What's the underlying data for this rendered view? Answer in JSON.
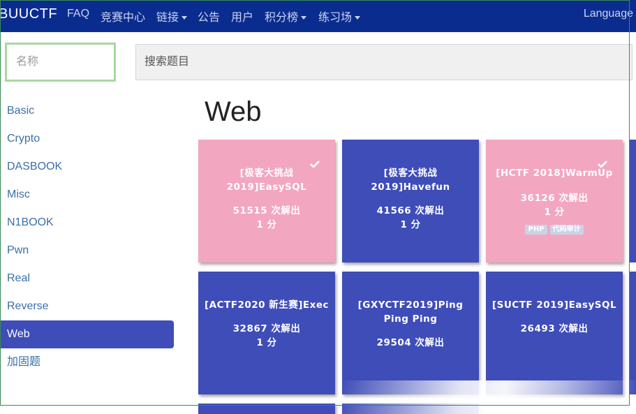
{
  "navbar": {
    "brand": "BUUCTF",
    "items": [
      {
        "label": "FAQ",
        "dropdown": false
      },
      {
        "label": "竞赛中心",
        "dropdown": false
      },
      {
        "label": "链接",
        "dropdown": true
      },
      {
        "label": "公告",
        "dropdown": false
      },
      {
        "label": "用户",
        "dropdown": false
      },
      {
        "label": "积分榜",
        "dropdown": true
      },
      {
        "label": "练习场",
        "dropdown": true
      }
    ],
    "language": "Language"
  },
  "filters": {
    "name_placeholder": "名称",
    "search_placeholder": "搜索题目"
  },
  "sidebar": {
    "items": [
      {
        "label": "Basic"
      },
      {
        "label": "Crypto"
      },
      {
        "label": "DASBOOK"
      },
      {
        "label": "Misc"
      },
      {
        "label": "N1BOOK"
      },
      {
        "label": "Pwn"
      },
      {
        "label": "Real"
      },
      {
        "label": "Reverse"
      },
      {
        "label": "Web",
        "active": true
      },
      {
        "label": "加固题"
      }
    ]
  },
  "main": {
    "title": "Web",
    "challenges": [
      {
        "name": "[极客大挑战 2019]EasySQL",
        "solves": "51515 次解出",
        "points": "1 分",
        "solved": true,
        "color": "pink",
        "tags": []
      },
      {
        "name": "[极客大挑战 2019]Havefun",
        "solves": "41566 次解出",
        "points": "1 分",
        "solved": false,
        "color": "blue",
        "tags": []
      },
      {
        "name": "[HCTF 2018]WarmUp",
        "solves": "36126 次解出",
        "points": "1 分",
        "solved": true,
        "color": "pink",
        "tags": [
          "PHP",
          "代码审计"
        ]
      },
      {
        "name": "[ACTF2020 新生赛]Exec",
        "solves": "32867 次解出",
        "points": "1 分",
        "solved": false,
        "color": "blue",
        "tags": []
      },
      {
        "name": "[GXYCTF2019]Ping Ping Ping",
        "solves": "29504 次解出",
        "points": "",
        "solved": false,
        "color": "blue",
        "tags": []
      },
      {
        "name": "[SUCTF 2019]EasySQL",
        "solves": "26493 次解出",
        "points": "",
        "solved": false,
        "color": "blue",
        "tags": []
      }
    ]
  },
  "colors": {
    "navbar": "#0b2c8f",
    "accent": "#3f4db8",
    "solved": "#f3a6bf",
    "link": "#3a6fa6"
  }
}
